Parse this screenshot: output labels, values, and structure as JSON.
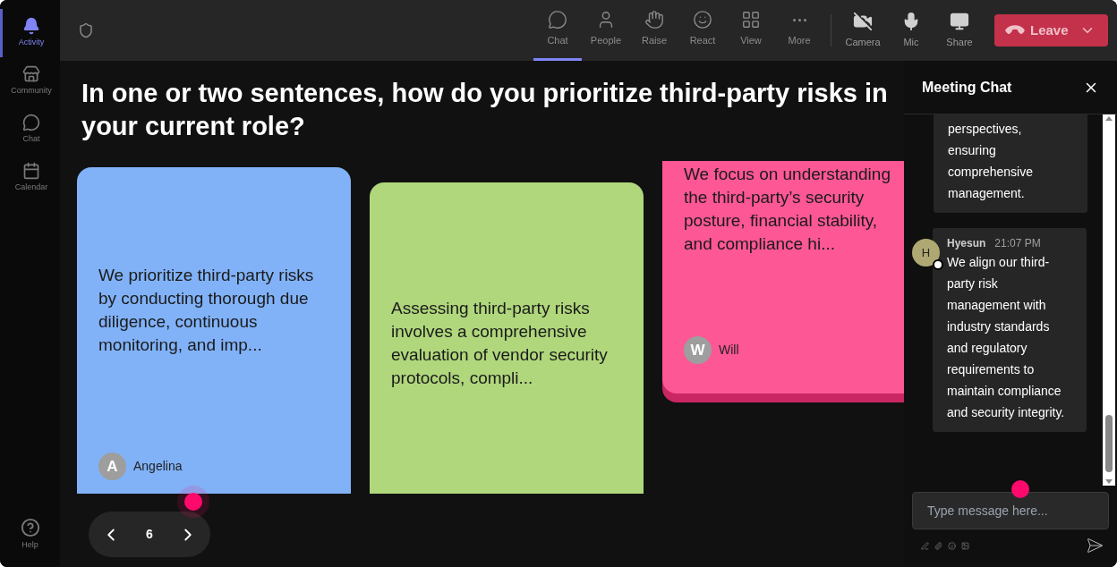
{
  "rail": [
    {
      "label": "Activity",
      "selected": true
    },
    {
      "label": "Community",
      "selected": false
    },
    {
      "label": "Chat",
      "selected": false
    },
    {
      "label": "Calendar",
      "selected": false
    }
  ],
  "rail_footer": {
    "label": "Help"
  },
  "toolbar": [
    {
      "label": "Chat",
      "selected": true
    },
    {
      "label": "People",
      "selected": false
    },
    {
      "label": "Raise",
      "selected": false
    },
    {
      "label": "React",
      "selected": false
    },
    {
      "label": "View",
      "selected": false
    },
    {
      "label": "More",
      "selected": false
    }
  ],
  "device_controls": [
    {
      "label": "Camera",
      "on": false
    },
    {
      "label": "Mic",
      "on": true
    },
    {
      "label": "Share",
      "on": false
    }
  ],
  "leave_button": {
    "label": "Leave"
  },
  "question": "In one or two sentences, how do you prioritize third-party risks in your current role?",
  "cards": [
    {
      "text": "We prioritize third-party risks by conducting thorough due diligence, continuous monitoring, and imp...",
      "author": "Angelina",
      "initial": "A",
      "color": "#81b2f8"
    },
    {
      "text": "Assessing third-party risks involves a comprehensive evaluation of vendor security protocols, compli...",
      "color": "#b0d77c"
    },
    {
      "text": "We focus on understanding the third-party’s security posture, financial stability, and compliance hi...",
      "author": "Will",
      "initial": "W",
      "color": "#fd5795"
    }
  ],
  "pager": {
    "page": "6"
  },
  "chat": {
    "title": "Meeting Chat",
    "messages": [
      {
        "text": "perspectives, ensuring comprehensive management."
      },
      {
        "initial": "H",
        "sender": "Hyesun",
        "time": "21:07 PM",
        "text": "We align our third-party risk management with industry standards and regulatory requirements to maintain compliance and security integrity."
      }
    ],
    "input": {
      "placeholder": "Type message here..."
    }
  }
}
